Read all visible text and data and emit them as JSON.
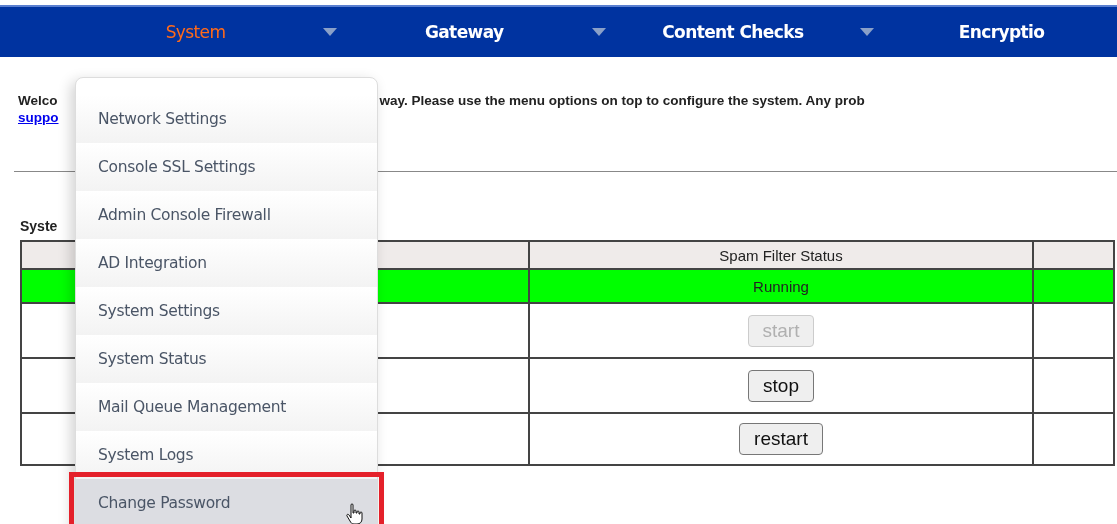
{
  "nav": {
    "items": [
      {
        "label": "System",
        "selected": true,
        "caret": true
      },
      {
        "label": "Gateway",
        "selected": false,
        "caret": true
      },
      {
        "label": "Content Checks",
        "selected": false,
        "caret": true
      },
      {
        "label": "Encryptio",
        "selected": false,
        "caret": false
      }
    ]
  },
  "welcome": {
    "start": "Welco",
    "rest": "way. Please use the menu options on top to configure the system. Any prob",
    "link": "suppo"
  },
  "section_title": "Syste",
  "table": {
    "columns": [
      "Spam Filter Status"
    ],
    "status": {
      "text": "Running",
      "color": "#00ff00"
    },
    "actions": [
      {
        "label": "start",
        "disabled": true
      },
      {
        "label": "stop",
        "disabled": false
      },
      {
        "label": "restart",
        "disabled": false
      }
    ]
  },
  "menu": {
    "items": [
      {
        "label": "Network Settings",
        "selected": false
      },
      {
        "label": "Console SSL Settings",
        "selected": false
      },
      {
        "label": "Admin Console Firewall",
        "selected": false
      },
      {
        "label": "AD Integration",
        "selected": false
      },
      {
        "label": "System Settings",
        "selected": false
      },
      {
        "label": "System Status",
        "selected": false
      },
      {
        "label": "Mail Queue Management",
        "selected": false
      },
      {
        "label": "System Logs",
        "selected": false
      },
      {
        "label": "Change Password",
        "selected": true
      }
    ]
  }
}
